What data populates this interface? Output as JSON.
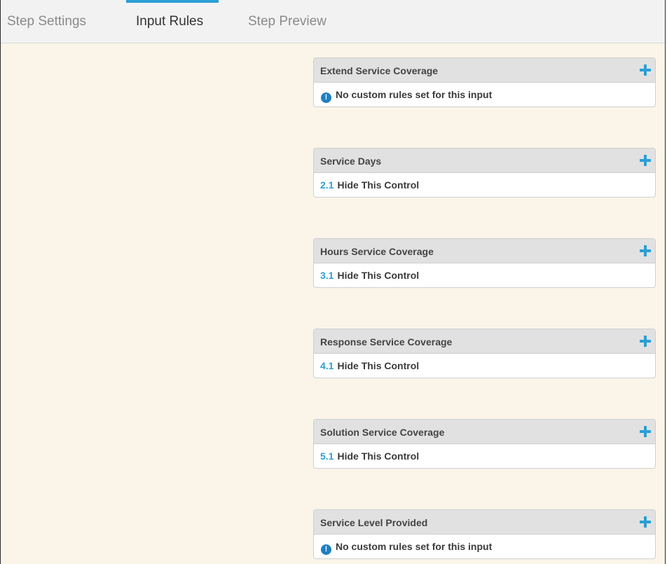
{
  "tabs": [
    {
      "label": "Step Settings",
      "active": false
    },
    {
      "label": "Input Rules",
      "active": true
    },
    {
      "label": "Step Preview",
      "active": false
    }
  ],
  "panels": [
    {
      "title": "Extend Service Coverage",
      "empty_text": "No custom rules set for this input"
    },
    {
      "title": "Service Days",
      "rule": {
        "number": "2.1",
        "label": "Hide This Control"
      }
    },
    {
      "title": "Hours Service Coverage",
      "rule": {
        "number": "3.1",
        "label": "Hide This Control"
      }
    },
    {
      "title": "Response Service Coverage",
      "rule": {
        "number": "4.1",
        "label": "Hide This Control"
      }
    },
    {
      "title": "Solution Service Coverage",
      "rule": {
        "number": "5.1",
        "label": "Hide This Control"
      }
    },
    {
      "title": "Service Level Provided",
      "empty_text": "No custom rules set for this input"
    }
  ],
  "icons": {
    "add": "plus-icon",
    "info": "info-icon"
  },
  "colors": {
    "accent": "#2b9fd6",
    "content_background": "#faf5e8",
    "panel_header": "#e1e1e1"
  }
}
